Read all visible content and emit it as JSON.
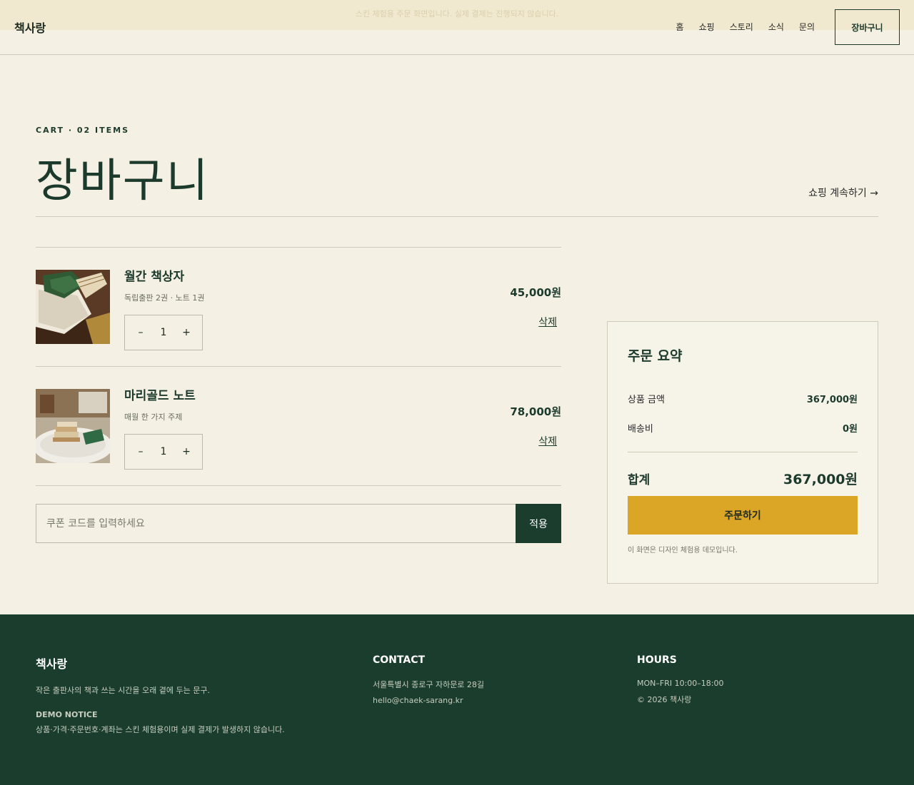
{
  "demo_banner": "스킨 체험용 주문 화면입니다. 실제 결제는 진행되지 않습니다.",
  "header": {
    "brand": "책사랑",
    "nav": [
      "홈",
      "쇼핑",
      "스토리",
      "소식",
      "문의"
    ],
    "cart_button": "장바구니"
  },
  "page": {
    "eyebrow": "CART · 02 ITEMS",
    "title": "장바구니",
    "continue_link": "쇼핑 계속하기 →"
  },
  "cart": {
    "items": [
      {
        "name": "월간 책상자",
        "sub": "독립출판 2권 · 노트 1권",
        "qty": "1",
        "price": "45,000원",
        "delete_label": "삭제",
        "minus": "–",
        "plus": "+"
      },
      {
        "name": "마리골드 노트",
        "sub": "매월 한 가지 주제",
        "qty": "1",
        "price": "78,000원",
        "delete_label": "삭제",
        "minus": "–",
        "plus": "+"
      }
    ]
  },
  "coupon": {
    "placeholder": "쿠폰 코드를 입력하세요",
    "apply_label": "적용"
  },
  "summary": {
    "title": "주문 요약",
    "subtotal_label": "상품 금액",
    "subtotal_value": "367,000원",
    "shipping_label": "배송비",
    "shipping_value": "0원",
    "total_label": "합계",
    "total_value": "367,000원",
    "order_button": "주문하기",
    "note": "이 화면은 디자인 체험용 데모입니다."
  },
  "footer": {
    "brand": "책사랑",
    "tagline": "작은 출판사의 책과 쓰는 시간을 오래 곁에 두는 문구.",
    "notice_head": "DEMO NOTICE",
    "notice_text": "상품·가격·주문번호·계좌는 스킨 체험용이며 실제 결제가 발생하지 않습니다.",
    "contact_head": "CONTACT",
    "address": "서울특별시 종로구 자하문로 28길",
    "email": "hello@chaek-sarang.kr",
    "hours_head": "HOURS",
    "hours": "MON–FRI 10:00–18:00",
    "copyright": "© 2026 책사랑"
  },
  "colors": {
    "background": "#f4f0e3",
    "primary_green": "#1b3d2d",
    "accent_gold": "#dba526"
  }
}
